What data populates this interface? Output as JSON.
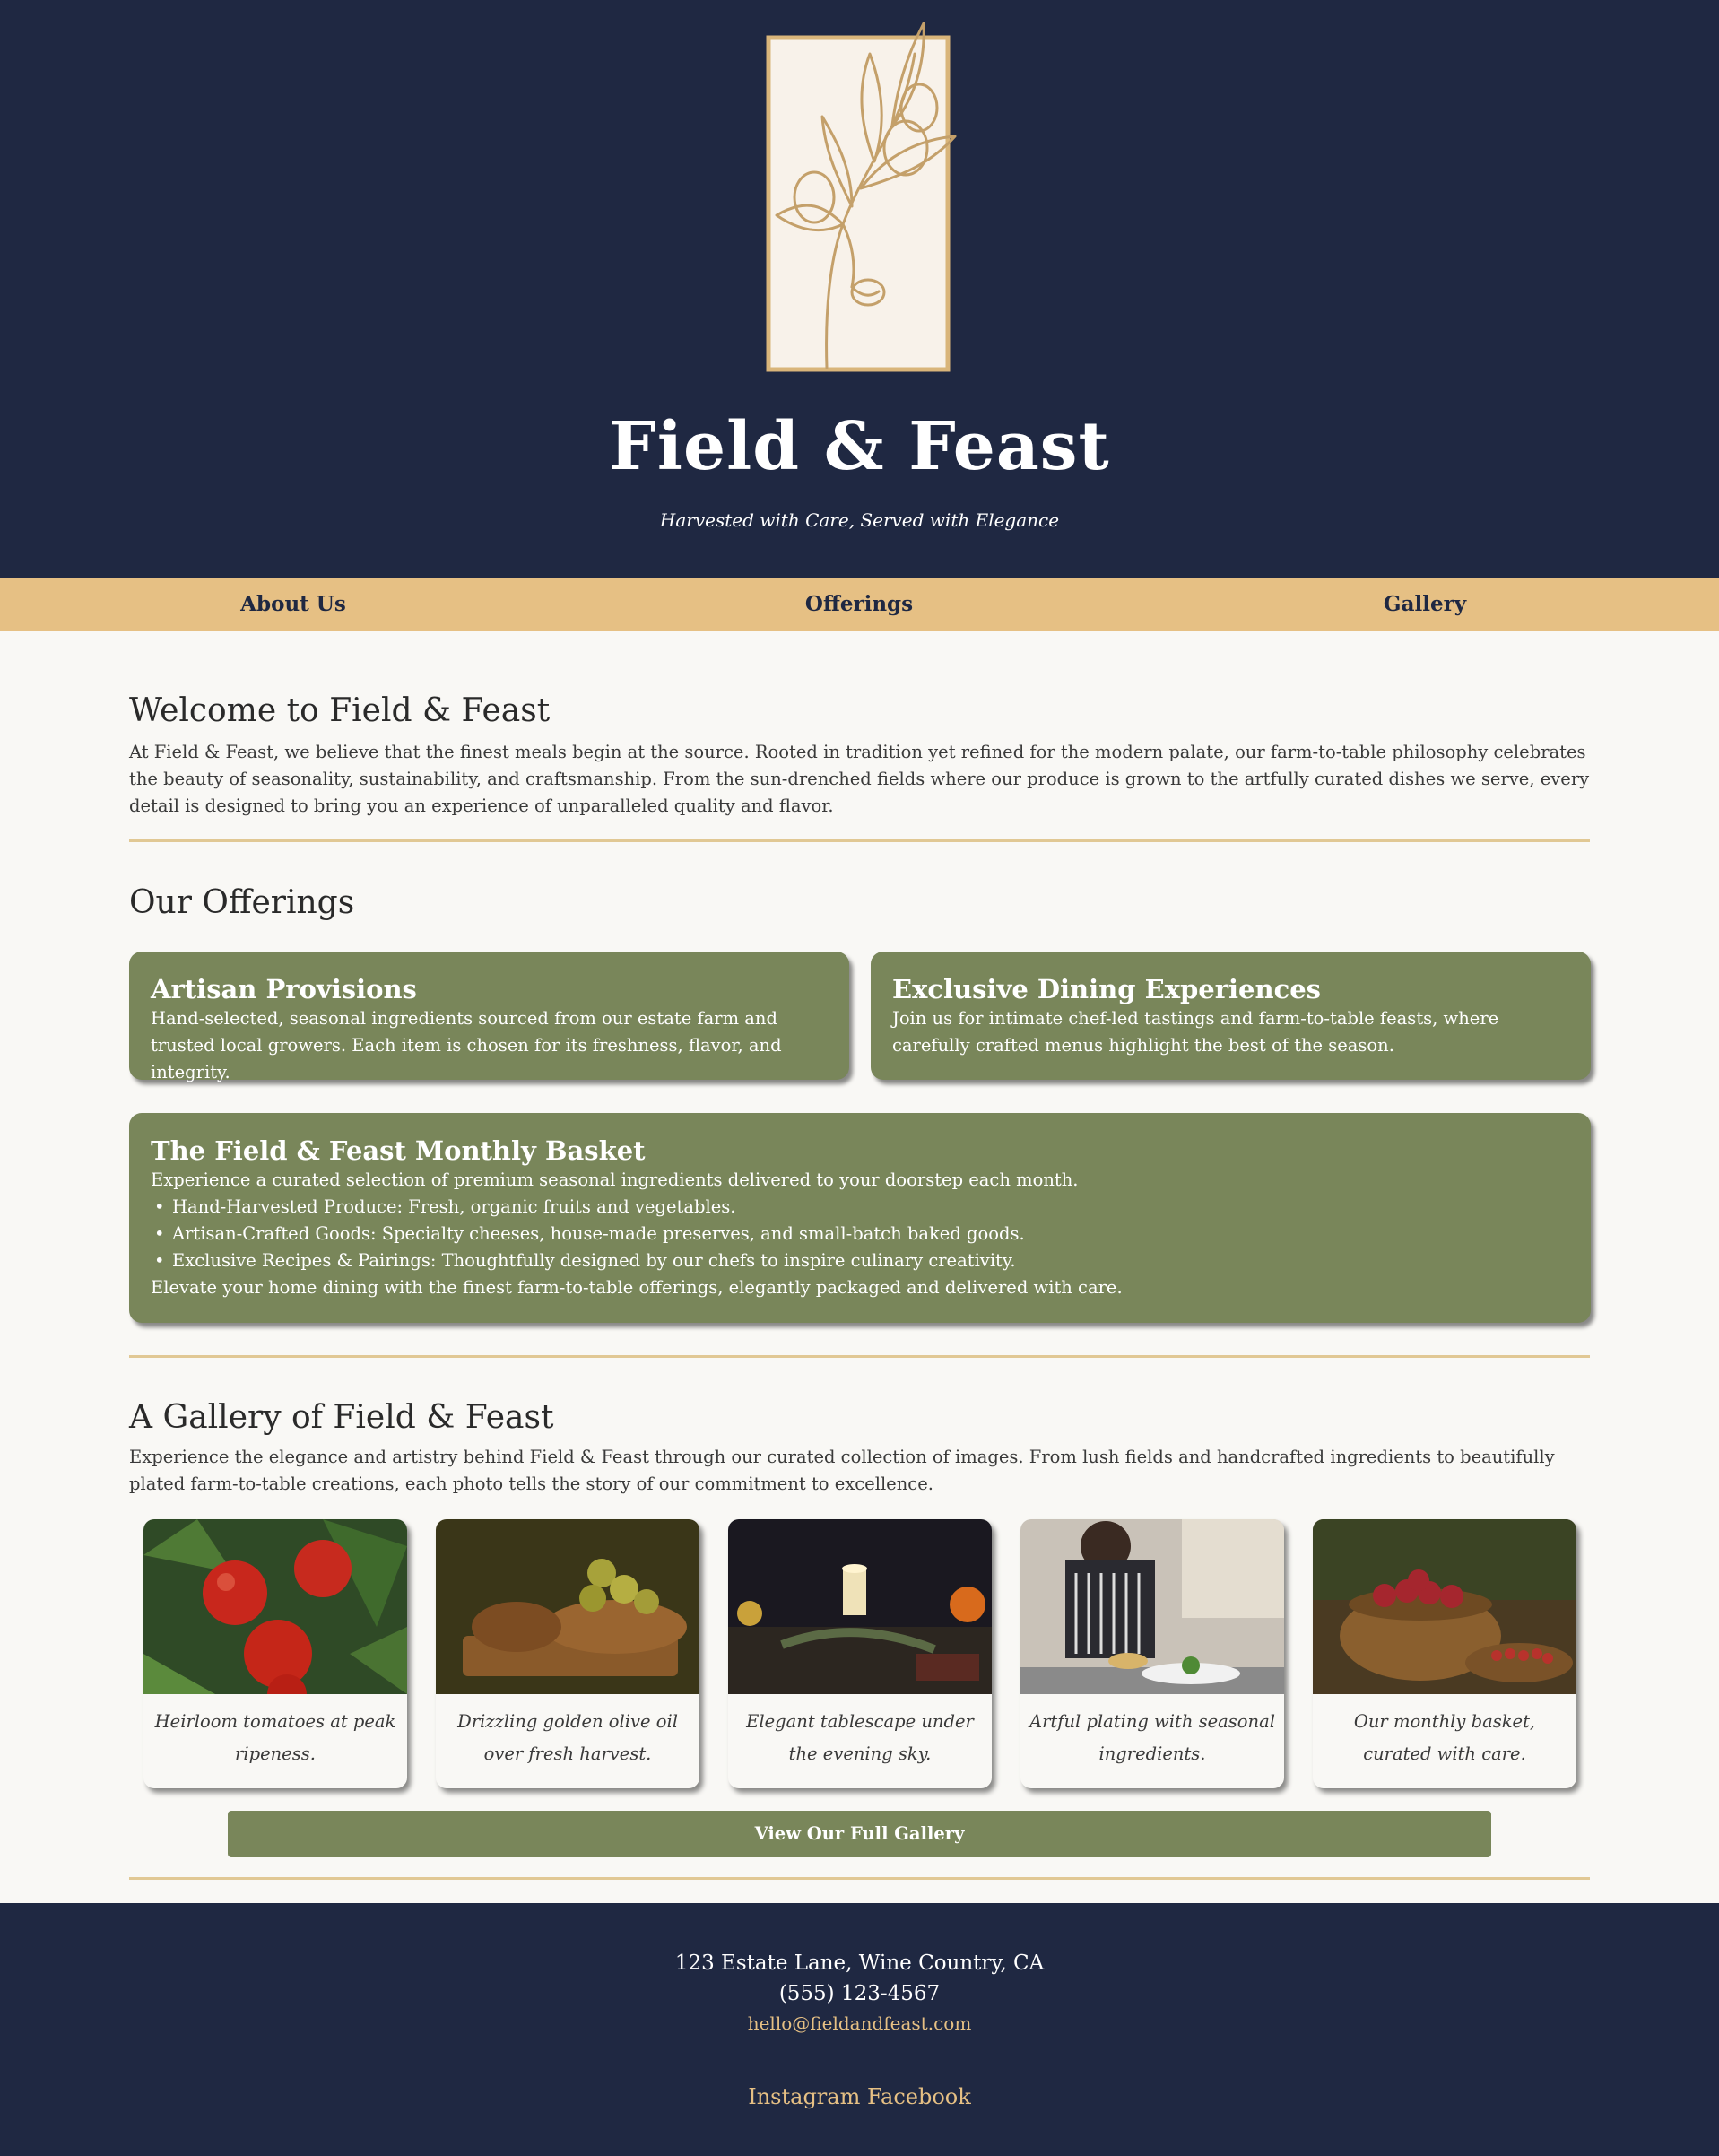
{
  "brand": {
    "title": "Field & Feast",
    "tagline": "Harvested with Care, Served with Elegance",
    "logo_icon": "olive-branch-icon"
  },
  "nav": {
    "items": [
      {
        "label": "About Us"
      },
      {
        "label": "Offerings"
      },
      {
        "label": "Gallery"
      }
    ]
  },
  "about": {
    "title": "Welcome to Field & Feast",
    "body": "At Field & Feast, we believe that the finest meals begin at the source. Rooted in tradition yet refined for the modern palate, our farm-to-table philosophy celebrates the beauty of seasonality, sustainability, and craftsmanship. From the sun-drenched fields where our produce is grown to the artfully curated dishes we serve, every detail is designed to bring you an experience of unparalleled quality and flavor."
  },
  "offerings": {
    "title": "Our Offerings",
    "cards": [
      {
        "title": "Artisan Provisions",
        "body": "Hand-selected, seasonal ingredients sourced from our estate farm and trusted local growers. Each item is chosen for its freshness, flavor, and integrity."
      },
      {
        "title": "Exclusive Dining Experiences",
        "body": "Join us for intimate chef-led tastings and farm-to-table feasts, where carefully crafted menus highlight the best of the season."
      }
    ],
    "basket": {
      "title": "The Field & Feast Monthly Basket",
      "intro": "Experience a curated selection of premium seasonal ingredients delivered to your doorstep each month.",
      "items": [
        "Hand-Harvested Produce: Fresh, organic fruits and vegetables.",
        "Artisan-Crafted Goods: Specialty cheeses, house-made preserves, and small-batch baked goods.",
        "Exclusive Recipes & Pairings: Thoughtfully designed by our chefs to inspire culinary creativity."
      ],
      "outro": "Elevate your home dining with the finest farm-to-table offerings, elegantly packaged and delivered with care."
    }
  },
  "gallery": {
    "title": "A Gallery of Field & Feast",
    "body": "Experience the elegance and artistry behind Field & Feast through our curated collection of images. From lush fields and handcrafted ingredients to beautifully plated farm-to-table creations, each photo tells the story of our commitment to excellence.",
    "items": [
      {
        "caption": "Heirloom tomatoes at peak ripeness."
      },
      {
        "caption": "Drizzling golden olive oil over fresh harvest."
      },
      {
        "caption": "Elegant tablescape under the evening sky."
      },
      {
        "caption": "Artful plating with seasonal ingredients."
      },
      {
        "caption": "Our monthly basket, curated with care."
      }
    ],
    "button_label": "View Our Full Gallery"
  },
  "footer": {
    "address": "123 Estate Lane, Wine Country, CA",
    "phone": "(555) 123-4567",
    "email": "hello@fieldandfeast.com",
    "social": [
      "Instagram",
      "Facebook"
    ]
  },
  "colors": {
    "navy": "#1f2842",
    "gold": "#e6c084",
    "olive": "#79865a",
    "cream": "#f9f8f5"
  }
}
